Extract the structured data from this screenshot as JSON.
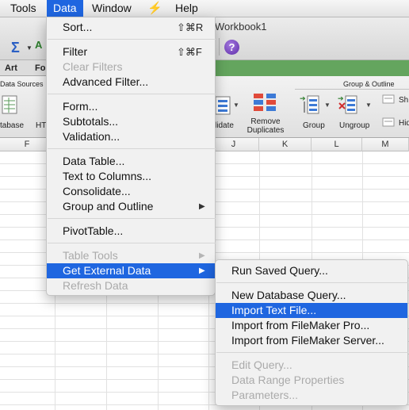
{
  "menubar": {
    "items": [
      {
        "label": "Tools"
      },
      {
        "label": "Data"
      },
      {
        "label": "Window"
      },
      {
        "label": "Help"
      }
    ],
    "script_glyph": "⚡"
  },
  "window": {
    "title": "Workbook1"
  },
  "ribbon": {
    "tabs": [
      "Art",
      "Fo"
    ],
    "groups": {
      "data_sources": "Data Sources",
      "group_outline": "Group & Outline"
    },
    "buttons": {
      "database": "tabase",
      "html": "HT",
      "consolidate": "lidate",
      "remove_duplicates_1": "Remove",
      "remove_duplicates_2": "Duplicates",
      "group": "Group",
      "ungroup": "Ungroup",
      "show": "Sh",
      "hide": "Hid"
    },
    "help_glyph": "?"
  },
  "columns": [
    "F",
    "J",
    "K",
    "L",
    "M"
  ],
  "data_menu": {
    "items": [
      {
        "label": "Sort...",
        "shortcut": "⇧⌘R"
      },
      {
        "label": "Filter",
        "shortcut": "⇧⌘F"
      },
      {
        "label": "Clear Filters"
      },
      {
        "label": "Advanced Filter..."
      },
      {
        "label": "Form..."
      },
      {
        "label": "Subtotals..."
      },
      {
        "label": "Validation..."
      },
      {
        "label": "Data Table..."
      },
      {
        "label": "Text to Columns..."
      },
      {
        "label": "Consolidate..."
      },
      {
        "label": "Group and Outline"
      },
      {
        "label": "PivotTable..."
      },
      {
        "label": "Table Tools"
      },
      {
        "label": "Get External Data"
      },
      {
        "label": "Refresh Data"
      }
    ]
  },
  "external_menu": {
    "items": [
      {
        "label": "Run Saved Query..."
      },
      {
        "label": "New Database Query..."
      },
      {
        "label": "Import Text File..."
      },
      {
        "label": "Import from FileMaker Pro..."
      },
      {
        "label": "Import from FileMaker Server..."
      },
      {
        "label": "Edit Query..."
      },
      {
        "label": "Data Range Properties"
      },
      {
        "label": "Parameters..."
      }
    ]
  },
  "colors": {
    "highlight": "#1f66e0",
    "ribbon_accent": "#64a55e",
    "disabled_text": "#aaaaaa"
  }
}
